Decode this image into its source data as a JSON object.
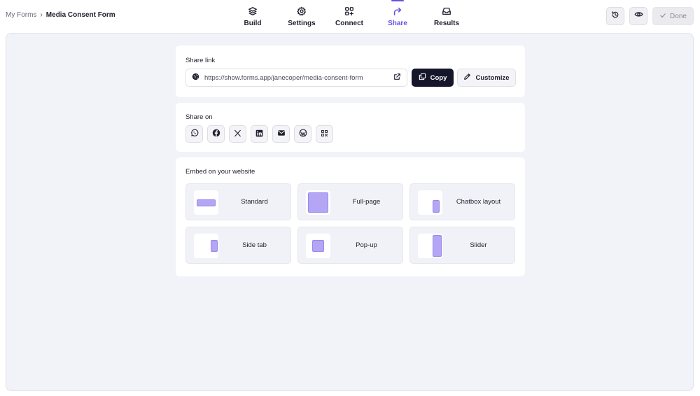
{
  "breadcrumb": {
    "parent": "My Forms",
    "separator": "›",
    "current": "Media Consent Form"
  },
  "nav": [
    {
      "label": "Build",
      "icon": "layers-icon"
    },
    {
      "label": "Settings",
      "icon": "gear-icon"
    },
    {
      "label": "Connect",
      "icon": "connect-grid-icon"
    },
    {
      "label": "Share",
      "icon": "share-arrow-icon",
      "active": true
    },
    {
      "label": "Results",
      "icon": "inbox-icon"
    }
  ],
  "top_actions": {
    "history_icon": "history-icon",
    "preview_icon": "eye-icon",
    "done_label": "Done"
  },
  "share_link": {
    "title": "Share link",
    "url": "https://show.forms.app/janecoper/media-consent-form",
    "copy_label": "Copy",
    "customize_label": "Customize"
  },
  "share_on": {
    "title": "Share on",
    "icons": [
      "whatsapp-icon",
      "facebook-icon",
      "x-icon",
      "linkedin-icon",
      "email-icon",
      "wordpress-icon",
      "qr-code-icon"
    ]
  },
  "embed": {
    "title": "Embed on your website",
    "options": [
      {
        "label": "Standard"
      },
      {
        "label": "Full-page"
      },
      {
        "label": "Chatbox layout"
      },
      {
        "label": "Side tab"
      },
      {
        "label": "Pop-up"
      },
      {
        "label": "Slider"
      }
    ]
  },
  "colors": {
    "accent": "#6a4fe0",
    "dark_button": "#16162a",
    "thumb_fill": "#b4a5f5",
    "canvas_bg": "#f2f3f8"
  }
}
